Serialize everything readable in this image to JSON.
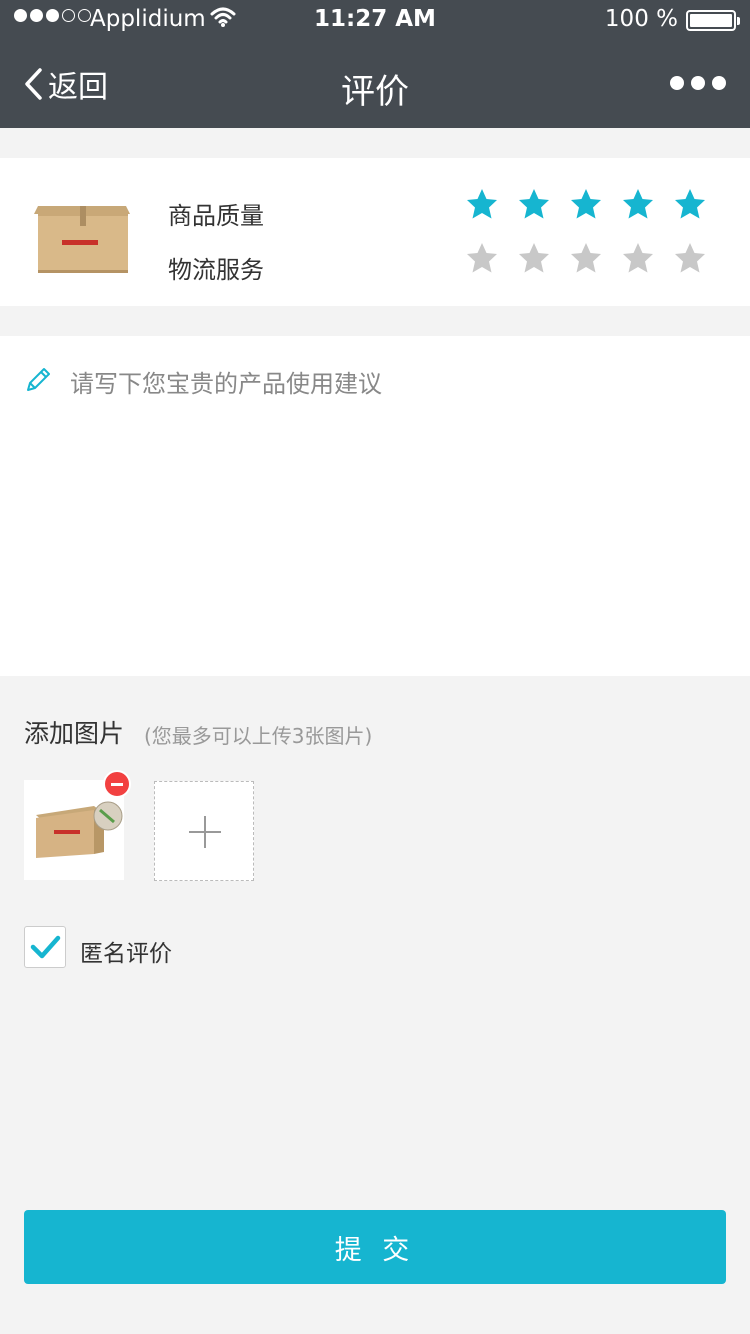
{
  "status_bar": {
    "carrier": "Applidium",
    "time": "11:27 AM",
    "battery": "100 %"
  },
  "nav": {
    "back_label": "返回",
    "title": "评价"
  },
  "rating": {
    "quality_label": "商品质量",
    "quality_score": 5,
    "logistics_label": "物流服务",
    "logistics_score": 0,
    "max_score": 5
  },
  "comment": {
    "placeholder": "请写下您宝贵的产品使用建议",
    "value": ""
  },
  "images": {
    "title": "添加图片",
    "hint": "(您最多可以上传3张图片)"
  },
  "anonymous": {
    "label": "匿名评价",
    "checked": true
  },
  "submit_label": "提 交",
  "colors": {
    "header": "#454b51",
    "accent": "#16b5d0",
    "star_off": "#c8c8c8",
    "remove": "#f24141"
  },
  "icons": [
    "chevron-left-icon",
    "more-icon",
    "star-icon",
    "pencil-icon",
    "plus-icon",
    "check-icon",
    "remove-icon"
  ]
}
